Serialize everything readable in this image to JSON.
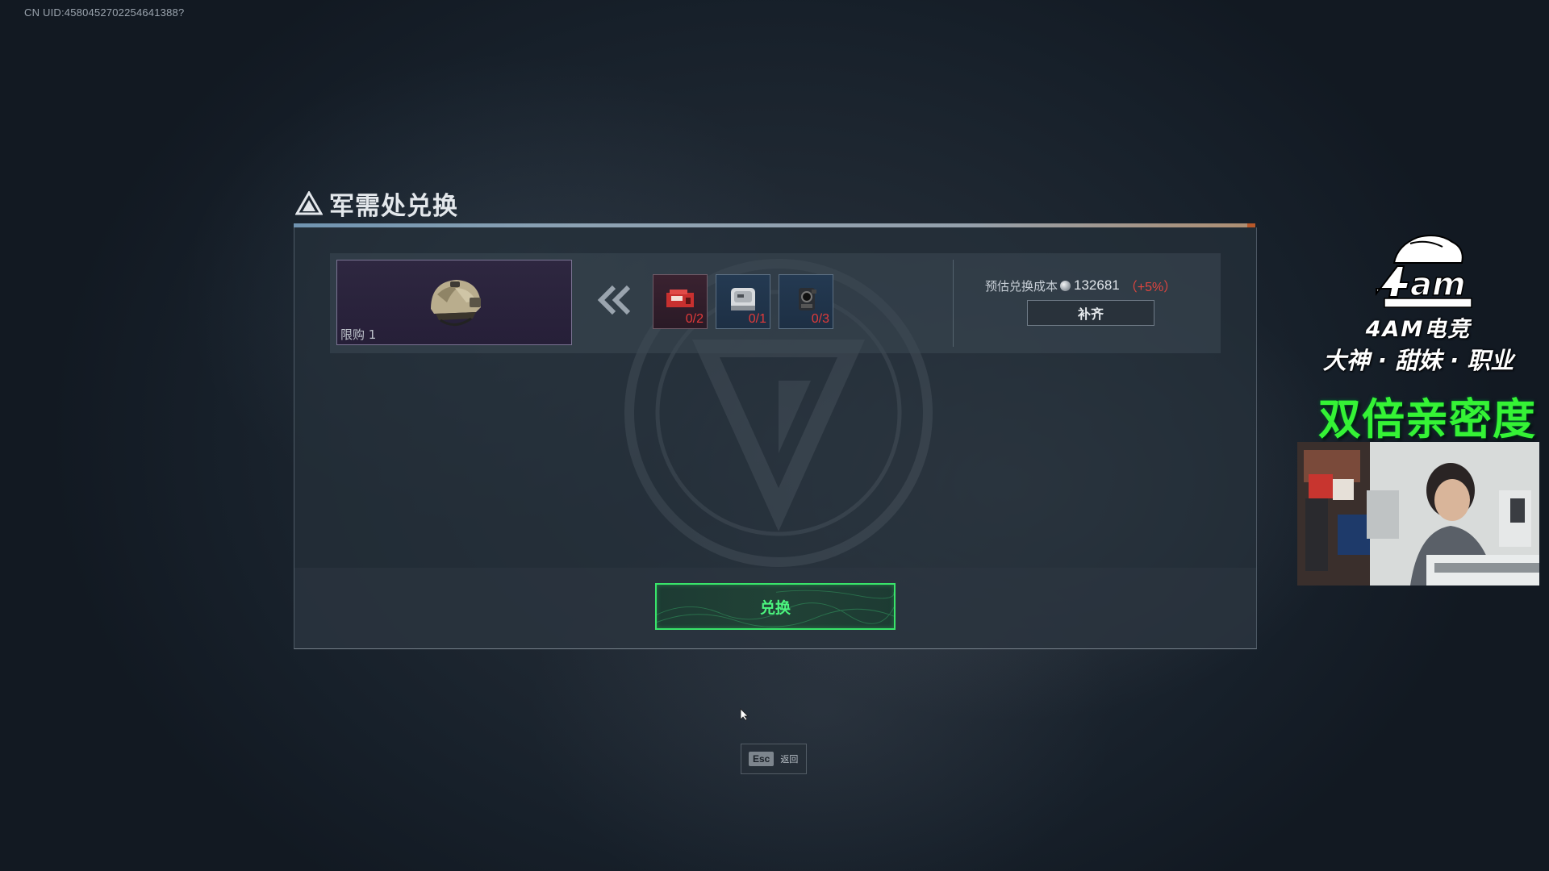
{
  "uid_text": "CN UID:4580452702254641388?",
  "dialog": {
    "title": "军需处兑换",
    "target_item": {
      "name": "helmet-icon",
      "limit_label": "限购 1"
    },
    "requirements": [
      {
        "icon": "red-device-icon",
        "count": "0/2"
      },
      {
        "icon": "white-box-icon",
        "count": "0/1"
      },
      {
        "icon": "camera-icon",
        "count": "0/3"
      }
    ],
    "cost": {
      "label": "预估兑换成本",
      "value": "132681",
      "extra": "（+5%）"
    },
    "fill_label": "补齐",
    "exchange_label": "兑换",
    "colors": {
      "accent_green": "#39e46a",
      "warning_red": "#e23a3a"
    }
  },
  "esc_hint": {
    "key": "Esc",
    "label": "返回"
  },
  "overlay": {
    "brand_name": "4AM电竞",
    "tagline": "大神 · 甜妹 · 职业",
    "promo": "双倍亲密度"
  }
}
